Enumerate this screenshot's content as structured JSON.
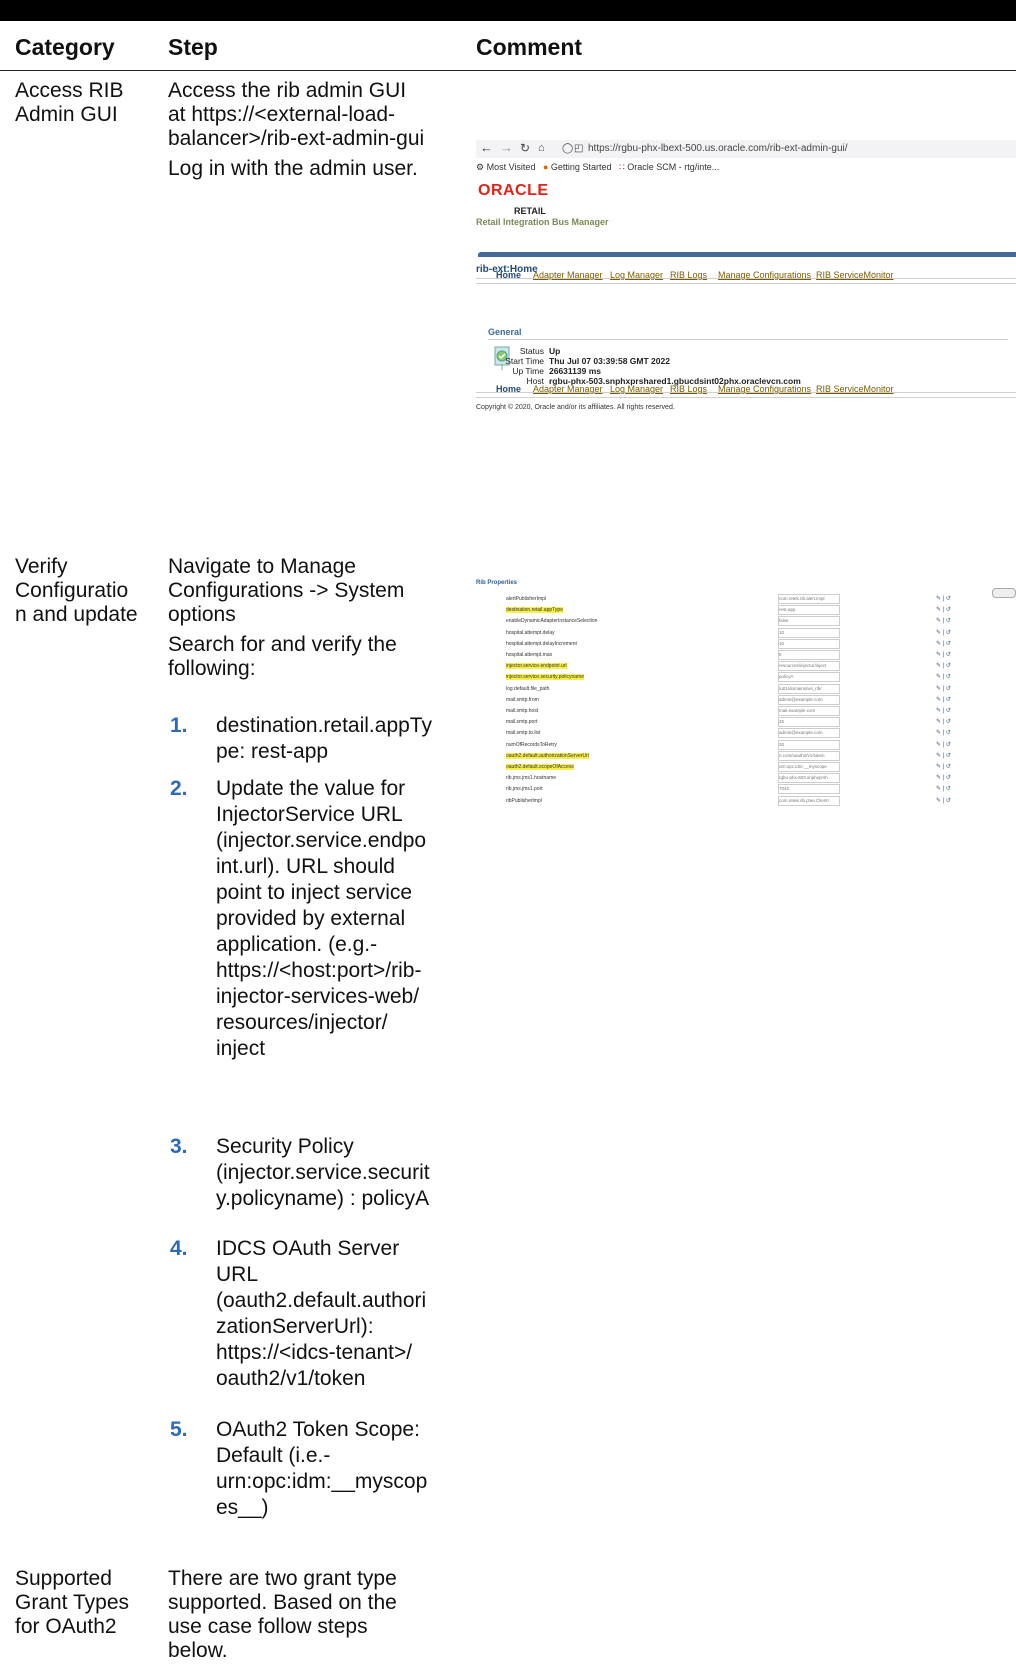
{
  "headers": {
    "category": "Category",
    "step": "Step",
    "comment": "Comment"
  },
  "rows": [
    {
      "category": [
        "Access RIB",
        "Admin GUI"
      ],
      "step_lines": [
        "Access the rib admin GUI",
        "at https://<external-load-",
        "balancer>/rib-ext-admin-gui"
      ],
      "step_extra": "Log in with the admin user."
    },
    {
      "category": [
        "Verify",
        "Configuratio",
        "n and update"
      ],
      "step_lines": [
        "Navigate to Manage",
        "Configurations -> System",
        "options"
      ],
      "step_extra_lines": [
        "Search for and verify the",
        "following:"
      ],
      "items": [
        {
          "num": "1.",
          "lines": [
            "destination.retail.appTy",
            "pe: rest-app"
          ]
        },
        {
          "num": "2.",
          "lines": [
            "Update the value for",
            "InjectorService URL",
            "(injector.service.endpo",
            "int.url). URL should",
            "point to inject service",
            "provided by external",
            "application. (e.g.-",
            "https://<host:port>/rib-",
            "injector-services-web/",
            "resources/injector/",
            "inject"
          ]
        },
        {
          "num": "3.",
          "lines": [
            "Security Policy",
            "(injector.service.securit",
            "y.policyname) : policyA"
          ]
        },
        {
          "num": "4.",
          "lines": [
            "IDCS OAuth Server",
            "URL",
            "(oauth2.default.authori",
            "zationServerUrl):",
            "https://<idcs-tenant>/",
            "oauth2/v1/token"
          ]
        },
        {
          "num": "5.",
          "lines": [
            "OAuth2 Token Scope:",
            "Default (i.e.-",
            "urn:opc:idm:__myscop",
            "es__)"
          ]
        }
      ]
    },
    {
      "category": [
        "Supported",
        "Grant Types",
        "for OAuth2"
      ],
      "step_lines": [
        "There are two grant type",
        "supported. Based on the",
        "use case follow steps",
        "below."
      ]
    }
  ],
  "screenshot1": {
    "url": "https://rgbu-phx-lbext-500.us.oracle.com/rib-ext-admin-gui/",
    "bookmarks": [
      "Most Visited",
      "Getting Started",
      "Oracle SCM - rtg/inte..."
    ],
    "logo": "ORACLE",
    "retail": "RETAIL",
    "subtitle": "Retail Integration Bus Manager",
    "page_title": "rib-ext:Home",
    "tabs": [
      "Home",
      "Adapter Manager",
      "Log Manager",
      "RIB Logs",
      "Manage Configurations",
      "RIB ServiceMonitor"
    ],
    "section": "General",
    "status_label": "Status",
    "status_value": "Up",
    "start_label": "Start Time",
    "start_value": "Thu Jul 07 03:39:58 GMT 2022",
    "uptime_label": "Up Time",
    "uptime_value": "26631139 ms",
    "host_label": "Host",
    "host_value": "rgbu-phx-503.snphxprshared1.gbucdsint02phx.oraclevcn.com",
    "copyright": "Copyright © 2020, Oracle and/or its affiliates. All rights reserved."
  },
  "screenshot2": {
    "title": "Rib Properties",
    "props": [
      {
        "key": "alertPublisherImpl",
        "val": "com.retek.rib.alert.impl",
        "hl": false
      },
      {
        "key": "destination.retail.appType",
        "val": "rest-app",
        "hl": true
      },
      {
        "key": "enableDynamicAdapterInstanceSelection",
        "val": "false",
        "hl": false
      },
      {
        "key": "hospital.attempt.delay",
        "val": "10",
        "hl": false
      },
      {
        "key": "hospital.attempt.delayIncrement",
        "val": "10",
        "hl": false
      },
      {
        "key": "hospital.attempt.max",
        "val": "5",
        "hl": false
      },
      {
        "key": "injector.service.endpoint.url",
        "val": "resources/injector/inject",
        "hl": true
      },
      {
        "key": "injector.service.security.policyname",
        "val": "policyA",
        "hl": true
      },
      {
        "key": "log.default.file_path",
        "val": "/u01/domains/ws_rib/",
        "hl": false
      },
      {
        "key": "mail.smtp.from",
        "val": "admin@example.com",
        "hl": false
      },
      {
        "key": "mail.smtp.host",
        "val": "mail.example.com",
        "hl": false
      },
      {
        "key": "mail.smtp.port",
        "val": "25",
        "hl": false
      },
      {
        "key": "mail.smtp.to.list",
        "val": "admin@example.com",
        "hl": false
      },
      {
        "key": "numOfRecordsToRetry",
        "val": "20",
        "hl": false
      },
      {
        "key": "oauth2.default.authorizationServerUrl",
        "val": "n.com/oauth2/v1/token",
        "hl": true
      },
      {
        "key": "oauth2.default.scopeOfAccess",
        "val": "urn:opc:idm:__myscope",
        "hl": true
      },
      {
        "key": "rib.jms.jms1.hostname",
        "val": "rgbu-phx-503.snphxprsh",
        "hl": false
      },
      {
        "key": "rib.jms.jms1.port",
        "val": "7042",
        "hl": false
      },
      {
        "key": "ribPublisherImpl",
        "val": "com.retek.rib.j2ee.ClientI",
        "hl": false
      }
    ]
  }
}
